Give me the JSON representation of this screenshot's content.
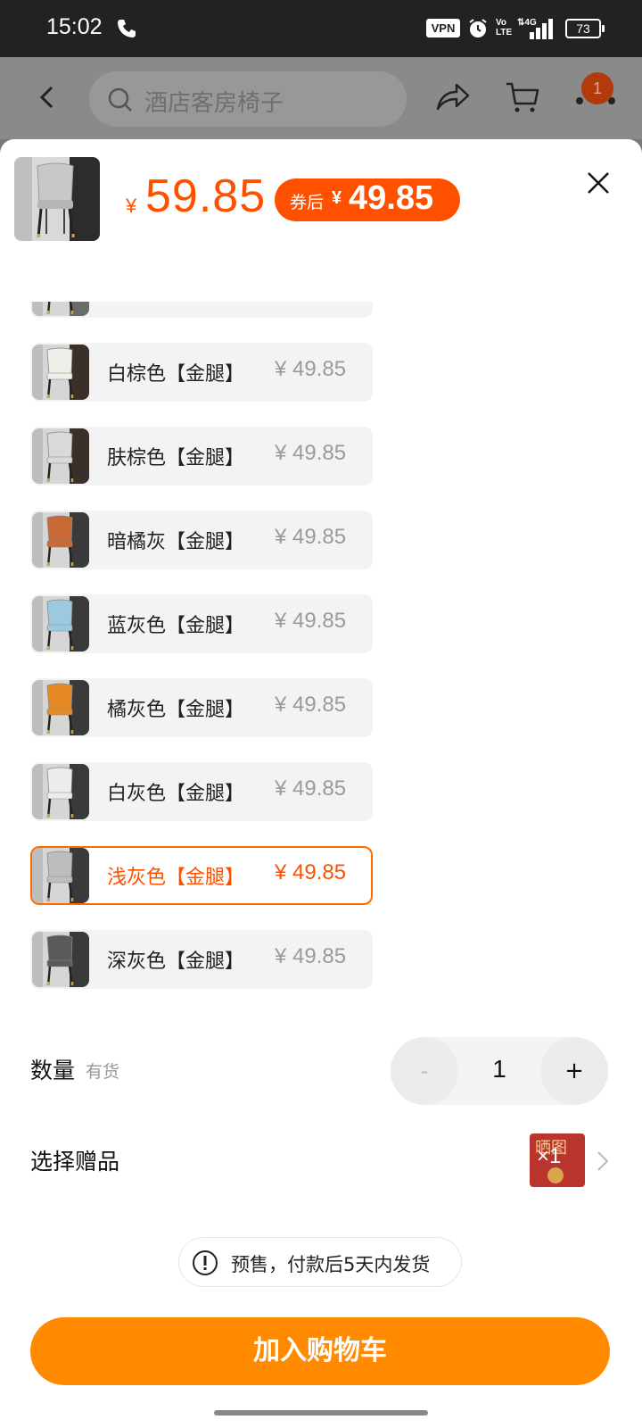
{
  "status_bar": {
    "time": "15:02",
    "vpn": "VPN",
    "volte": "Vo\nLTE",
    "network": "4G",
    "battery": "73"
  },
  "header": {
    "search_text": "酒店客房椅子",
    "cart_badge": "1"
  },
  "product": {
    "price_currency": "¥",
    "price": "59.85",
    "coupon_label": "券后",
    "coupon_currency": "¥",
    "coupon_price": "49.85"
  },
  "options": [
    {
      "label": "",
      "price": "",
      "color": "#6b6b6b",
      "seat": "#d8d8d8"
    },
    {
      "label": "白棕色【金腿】",
      "price": "¥ 49.85",
      "color": "#3b2f2a",
      "seat": "#efefe9"
    },
    {
      "label": "肤棕色【金腿】",
      "price": "¥ 49.85",
      "color": "#3b2f2a",
      "seat": "#d9d9d9"
    },
    {
      "label": "暗橘灰【金腿】",
      "price": "¥ 49.85",
      "color": "#3a3a3a",
      "seat": "#c86a35"
    },
    {
      "label": "蓝灰色【金腿】",
      "price": "¥ 49.85",
      "color": "#3a3a3a",
      "seat": "#9cc8e0"
    },
    {
      "label": "橘灰色【金腿】",
      "price": "¥ 49.85",
      "color": "#3a3a3a",
      "seat": "#e58a22"
    },
    {
      "label": "白灰色【金腿】",
      "price": "¥ 49.85",
      "color": "#3a3a3a",
      "seat": "#ececec"
    },
    {
      "label": "浅灰色【金腿】",
      "price": "¥ 49.85",
      "color": "#3a3a3a",
      "seat": "#bdbdbd",
      "selected": true
    },
    {
      "label": "深灰色【金腿】",
      "price": "¥ 49.85",
      "color": "#3a3a3a",
      "seat": "#5a5a5a"
    }
  ],
  "quantity": {
    "label": "数量",
    "stock": "有货",
    "minus": "-",
    "value": "1",
    "plus": "+"
  },
  "gift": {
    "label": "选择赠品",
    "thumb_text": "晒图",
    "count": "×1"
  },
  "notice": {
    "text": "预售，付款后5天内发货"
  },
  "actions": {
    "add_to_cart": "加入购物车"
  },
  "colors": {
    "accent": "#ff5000",
    "button": "#ff8a00"
  }
}
